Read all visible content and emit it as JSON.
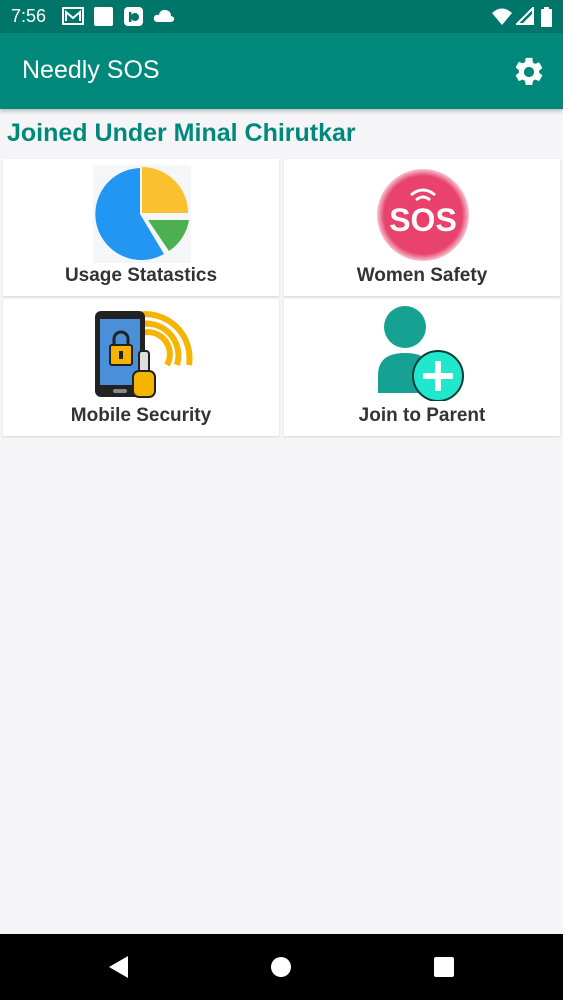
{
  "status_bar": {
    "time": "7:56",
    "left_icons": [
      "gmail-icon",
      "square-app-icon",
      "tickticket-icon",
      "cloud-icon"
    ],
    "right_icons": [
      "wifi-icon",
      "cellular-signal-icon",
      "battery-icon"
    ]
  },
  "app_bar": {
    "title": "Needly SOS",
    "settings_icon": "gear-icon"
  },
  "subtitle": "Joined Under Minal Chirutkar",
  "cards": [
    {
      "label": "Usage Statastics",
      "icon": "pie-chart-icon"
    },
    {
      "label": "Women Safety",
      "icon": "sos-icon",
      "icon_text": "SOS"
    },
    {
      "label": "Mobile Security",
      "icon": "phone-lock-icon"
    },
    {
      "label": "Join to Parent",
      "icon": "add-user-icon"
    }
  ],
  "nav_bar": [
    "back-icon",
    "home-icon",
    "recents-icon"
  ],
  "colors": {
    "primary": "#00897b",
    "primary_dark": "#00766a",
    "background": "#f5f5f7"
  }
}
